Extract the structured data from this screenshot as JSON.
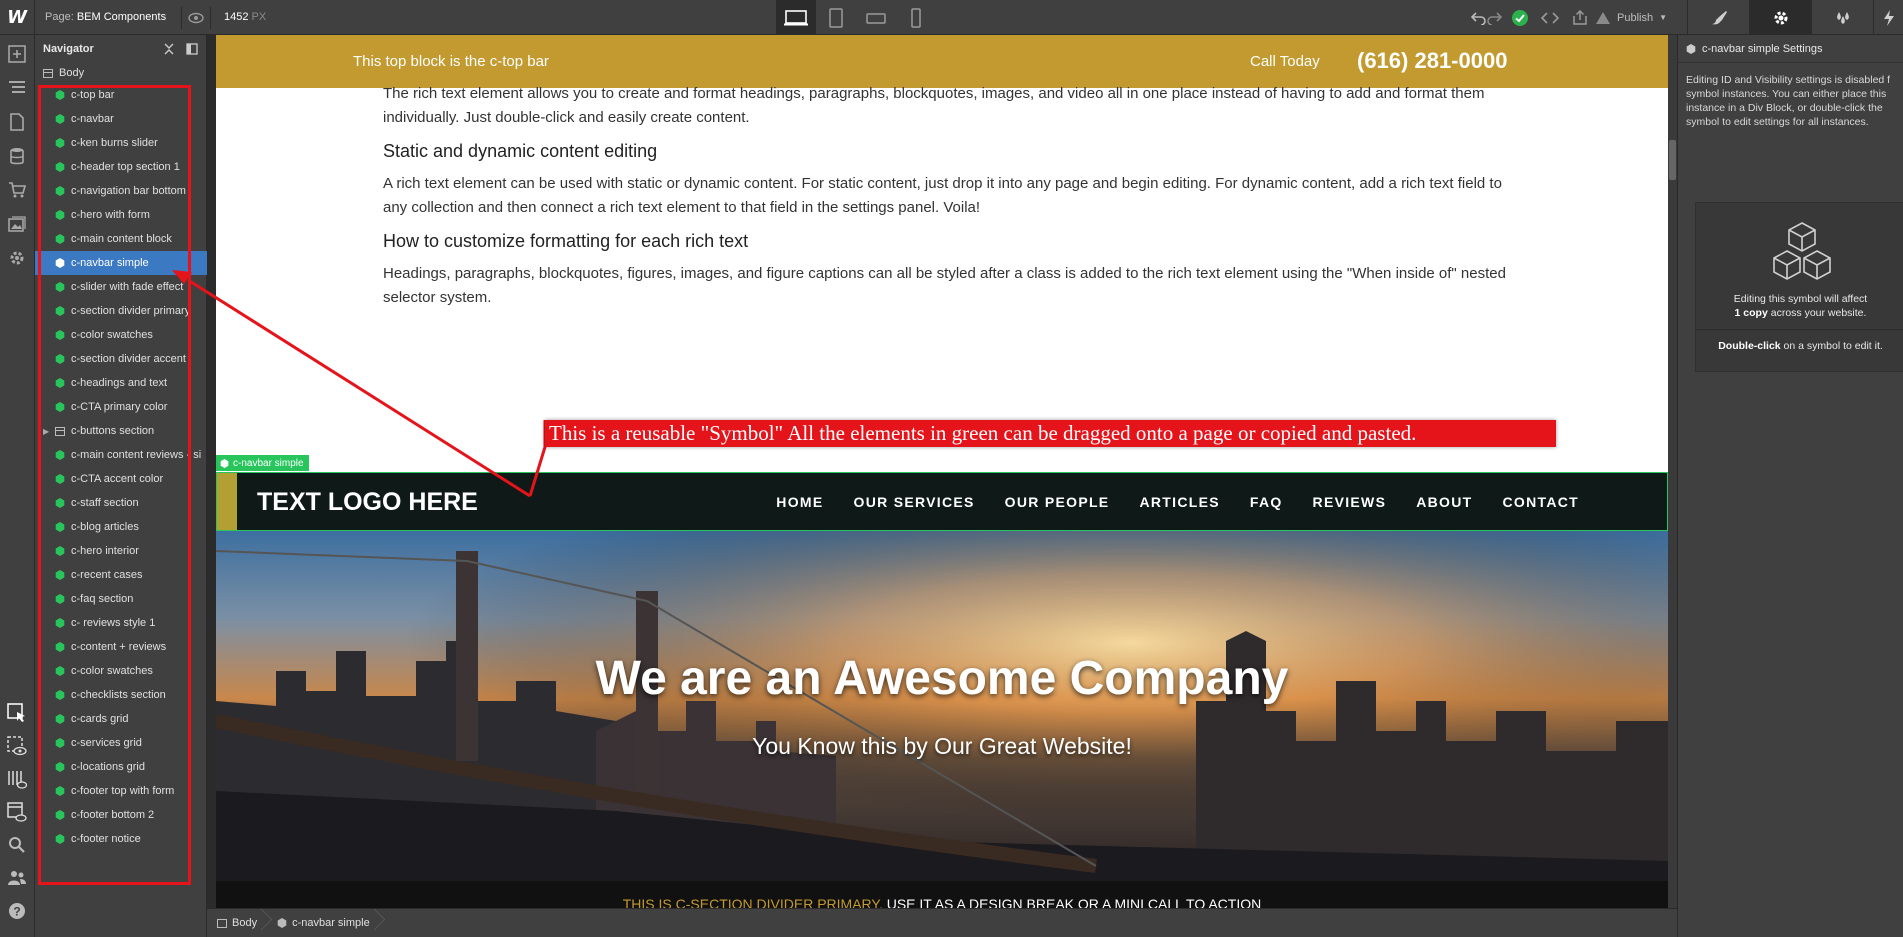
{
  "app": {
    "logo": "W",
    "page_label": "Page:",
    "page_name": "BEM Components",
    "canvas_width": "1452",
    "canvas_unit": "PX",
    "publish_label": "Publish"
  },
  "navigator": {
    "title": "Navigator",
    "root": "Body",
    "items": [
      {
        "label": "c-top bar"
      },
      {
        "label": "c-navbar"
      },
      {
        "label": "c-ken burns slider"
      },
      {
        "label": "c-header top section 1"
      },
      {
        "label": "c-navigation bar bottom"
      },
      {
        "label": "c-hero with form"
      },
      {
        "label": "c-main content block"
      },
      {
        "label": "c-navbar simple"
      },
      {
        "label": "c-slider with fade effect"
      },
      {
        "label": "c-section divider primary"
      },
      {
        "label": "c-color swatches"
      },
      {
        "label": "c-section divider accent"
      },
      {
        "label": "c-headings and text"
      },
      {
        "label": "c-CTA primary color"
      },
      {
        "label": "c-buttons section"
      },
      {
        "label": "c-main content reviews - si"
      },
      {
        "label": "c-CTA accent color"
      },
      {
        "label": "c-staff section"
      },
      {
        "label": "c-blog articles"
      },
      {
        "label": "c-hero interior"
      },
      {
        "label": "c-recent cases"
      },
      {
        "label": "c-faq section"
      },
      {
        "label": "c- reviews style 1"
      },
      {
        "label": "c-content + reviews"
      },
      {
        "label": "c-color swatches"
      },
      {
        "label": "c-checklists section"
      },
      {
        "label": "c-cards grid"
      },
      {
        "label": "c-services grid"
      },
      {
        "label": "c-locations grid"
      },
      {
        "label": "c-footer top with form"
      },
      {
        "label": "c-footer bottom 2"
      },
      {
        "label": "c-footer notice"
      }
    ],
    "selected_index": 7
  },
  "canvas": {
    "topbar": {
      "message": "This top block is the c-top bar",
      "call_label": "Call Today",
      "phone": "(616) 281-0000"
    },
    "rich_text": {
      "p1": "The rich text element allows you to create and format headings, paragraphs, blockquotes, images, and video all in one place instead of having to add and format them individually. Just double-click and easily create content.",
      "h2": "Static and dynamic content editing",
      "p2": "A rich text element can be used with static or dynamic content. For static content, just drop it into any page and begin editing. For dynamic content, add a rich text field to any collection and then connect a rich text element to that field in the settings panel. Voila!",
      "h3": "How to customize formatting for each rich text",
      "p3": "Headings, paragraphs, blockquotes, figures, images, and figure captions can all be styled after a class is added to the rich text element using the \"When inside of\" nested selector system."
    },
    "symbol_tag": "c-navbar simple",
    "navbar": {
      "logo": "TEXT LOGO HERE",
      "links": [
        "HOME",
        "OUR SERVICES",
        "OUR PEOPLE",
        "ARTICLES",
        "FAQ",
        "REVIEWS",
        "ABOUT",
        "CONTACT"
      ]
    },
    "hero": {
      "title": "We are an Awesome Company",
      "subtitle": "You Know this by Our Great Website!"
    },
    "divider": {
      "gold_text": "THIS IS C-SECTION DIVIDER PRIMARY.",
      "text": " USE IT AS A DESIGN BREAK OR A MINI CALL TO ACTION"
    }
  },
  "callout": "This is a reusable \"Symbol\" All the elements in green can be dragged onto a page or copied and pasted.",
  "breadcrumb": [
    "Body",
    "c-navbar simple"
  ],
  "right_panel": {
    "title": "c-navbar simple Settings",
    "note_lines": [
      "Editing ID and Visibility settings is disabled f",
      "symbol instances. You can either place this",
      "instance in a Div Block, or double-click the",
      "symbol to edit settings for all instances."
    ],
    "affect_line1": "Editing this symbol will affect",
    "affect_bold": "1 copy",
    "affect_line2_rest": " across your website.",
    "dbl_bold": "Double-click",
    "dbl_rest": " on a symbol to edit it."
  },
  "colors": {
    "gold": "#c29a2f",
    "symbol_green": "#27c55c",
    "selection_blue": "#3b79c3",
    "annotation_red": "#e5141b",
    "publish_check": "#2bb24c"
  }
}
